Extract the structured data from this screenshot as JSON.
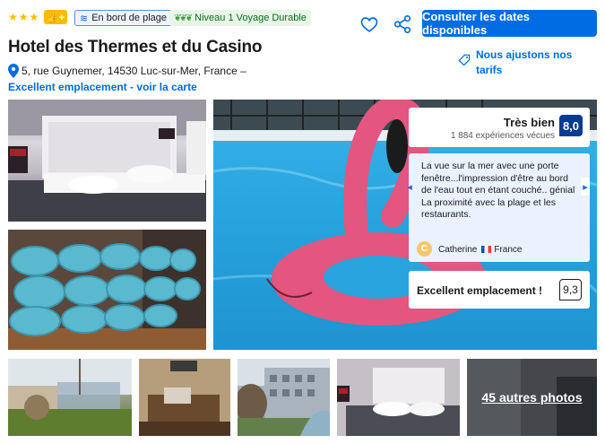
{
  "header": {
    "stars": 3,
    "thumbs_icon": "thumbs-up-plus-icon",
    "badges": {
      "beach": {
        "icon": "beach-waves-icon",
        "label": "En bord de plage"
      },
      "sustain": {
        "icon": "leaf-icon",
        "label": "Niveau 1 Voyage Durable"
      }
    },
    "favorite_icon": "heart-icon",
    "share_icon": "share-icon",
    "cta_label": "Consulter les dates disponibles"
  },
  "hotel": {
    "name": "Hotel des Thermes et du Casino",
    "pin_icon": "map-pin-icon",
    "address": "5, rue Guynemer, 14530 Luc-sur-Mer, France –",
    "location_link": "Excellent emplacement - voir la carte"
  },
  "price_match": {
    "icon": "price-tag-icon",
    "label": "Nous ajustons nos tarifs"
  },
  "review_summary": {
    "word": "Très bien",
    "count": "1 884 expériences vécues",
    "score": "8,0"
  },
  "featured_review": {
    "text": "La vue sur la mer avec une porte fenêtre...l'impression d'être au bord de l'eau tout en étant couché.. génial La proximité avec la plage et les restaurants.",
    "avatar_letter": "C",
    "reviewer": "Catherine",
    "country": "France",
    "prev_icon": "chevron-left-icon",
    "next_icon": "chevron-right-icon"
  },
  "location_score": {
    "label": "Excellent emplacement !",
    "score": "9,3"
  },
  "gallery": {
    "more_photos_label": "45 autres photos"
  },
  "colors": {
    "brand_blue": "#006ce4",
    "score_dark_blue": "#003b95",
    "star_yellow": "#febb02"
  }
}
